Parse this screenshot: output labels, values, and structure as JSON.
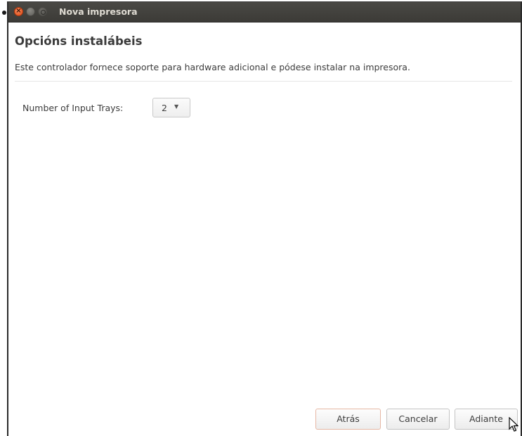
{
  "window": {
    "title": "Nova impresora"
  },
  "page": {
    "heading": "Opcións instalábeis",
    "description": "Este controlador fornece soporte para hardware adicional e pódese instalar na impresora."
  },
  "options": {
    "input_trays_label": "Number of Input Trays:",
    "input_trays_value": "2"
  },
  "buttons": {
    "back": "Atrás",
    "cancel": "Cancelar",
    "next": "Adiante"
  },
  "colors": {
    "titlebar": "#3c3b37",
    "close_button": "#df4a16",
    "text": "#3c3c3c"
  }
}
